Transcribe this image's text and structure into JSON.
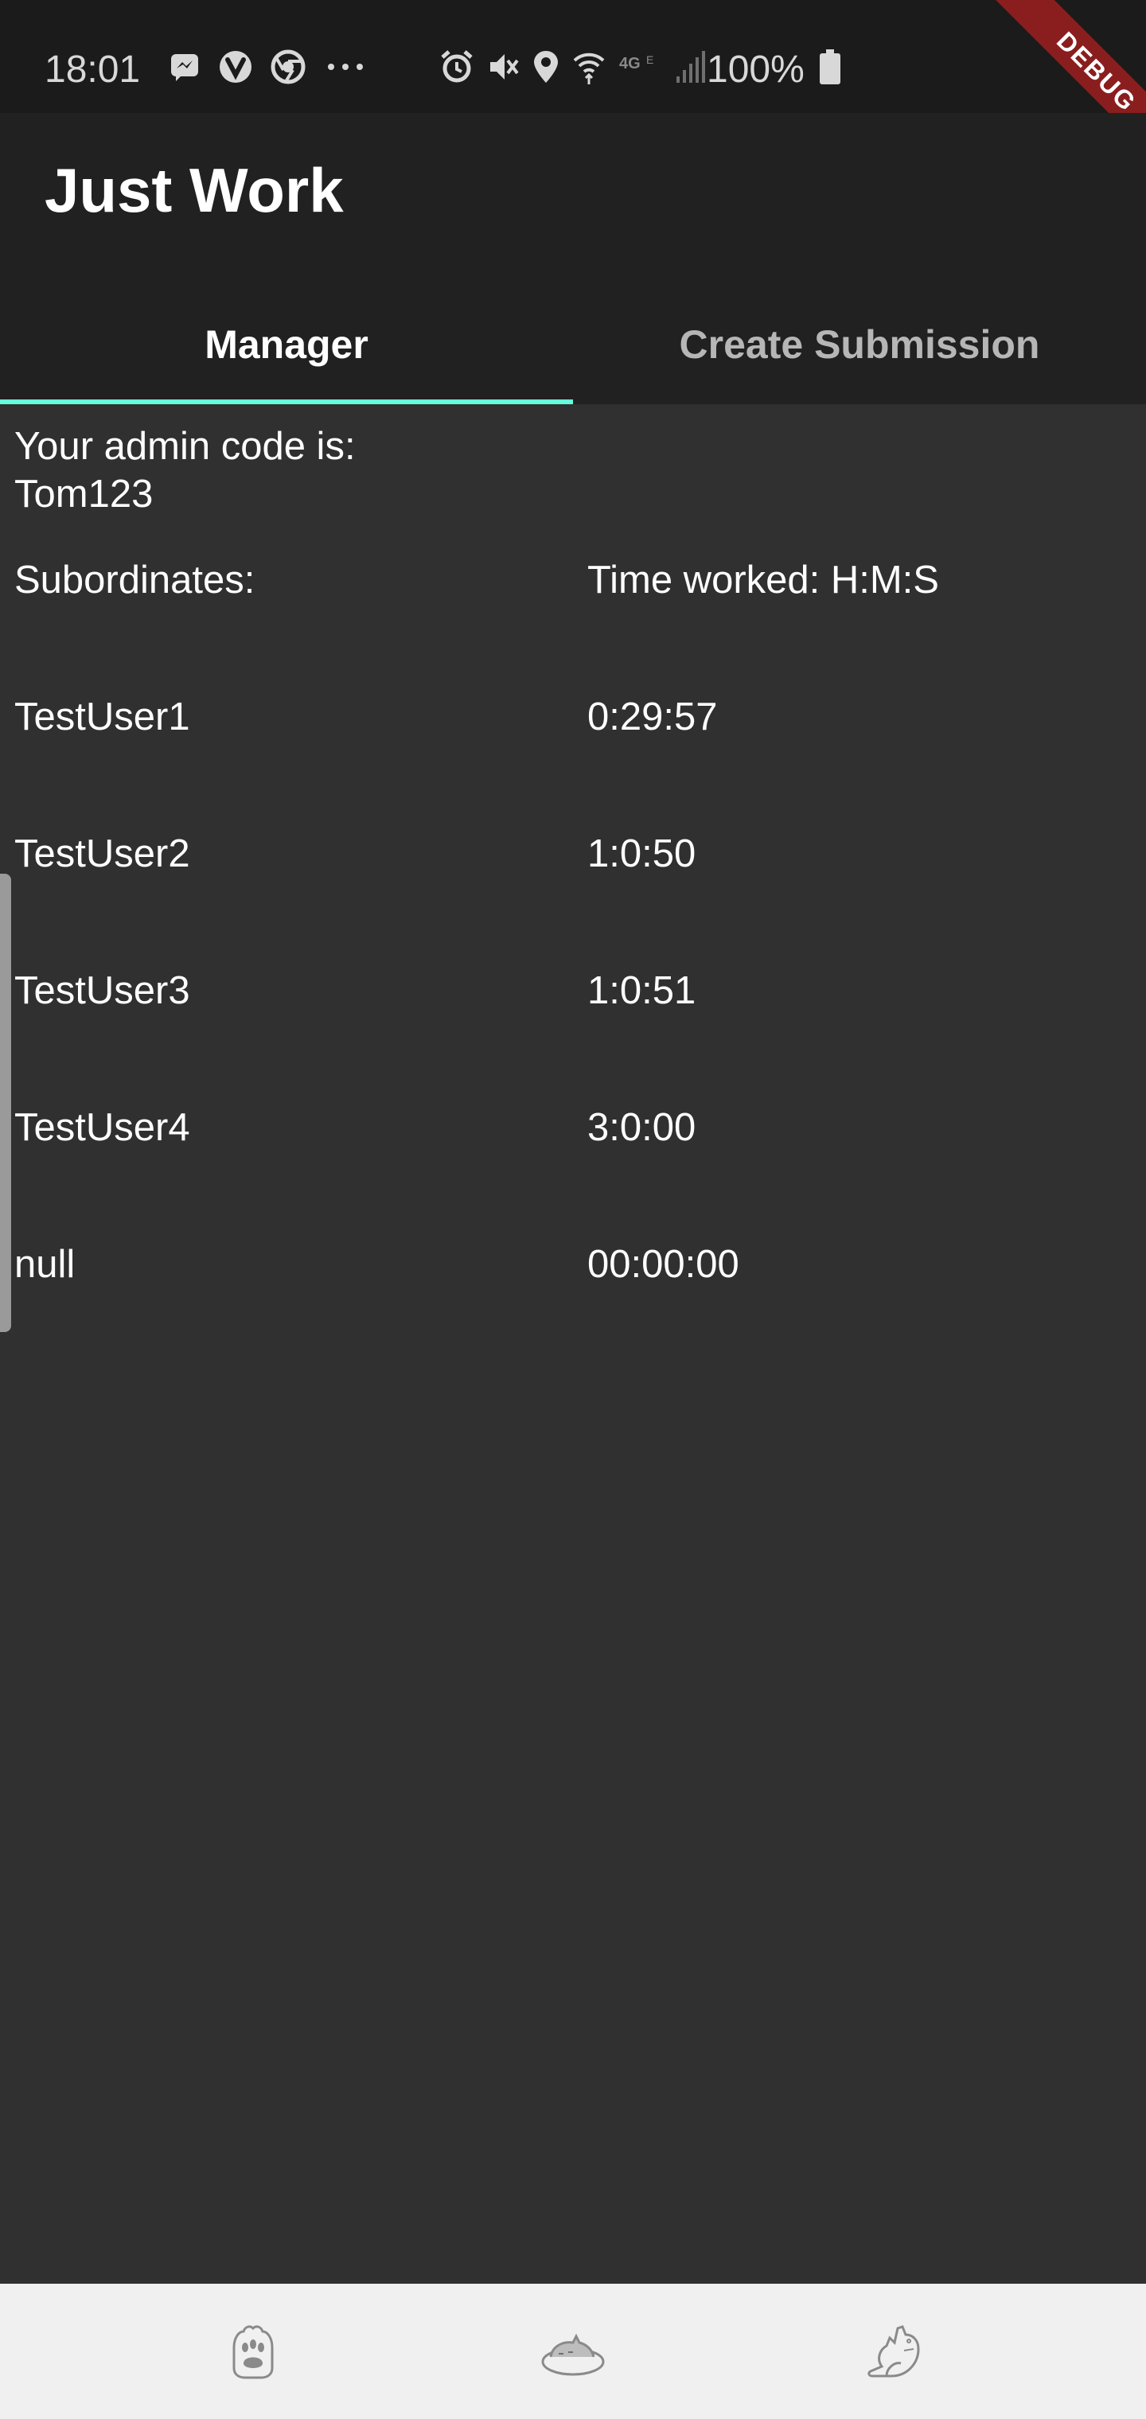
{
  "status_bar": {
    "time": "18:01",
    "battery": "100%",
    "icons_left": [
      "messenger-icon",
      "vivaldi-icon",
      "chrome-icon",
      "more-dots-icon"
    ],
    "icons_right": [
      "alarm-icon",
      "vibrate-icon",
      "location-icon",
      "wifi-icon",
      "network-4g-icon",
      "signal-icon",
      "battery-icon"
    ]
  },
  "debug_banner": "DEBUG",
  "app_bar": {
    "title": "Just Work"
  },
  "tabs": [
    {
      "label": "Manager",
      "selected": true
    },
    {
      "label": "Create Submission",
      "selected": false
    }
  ],
  "colors": {
    "accent": "#64ffda",
    "background": "#303030",
    "appbar": "#212121",
    "statusbar": "#1b1b1b",
    "bottom_nav": "#f0f0f0",
    "debug": "#8a1e1e"
  },
  "manager": {
    "admin_label": "Your admin code is:",
    "admin_code": "Tom123",
    "columns": {
      "name": "Subordinates:",
      "time": "Time worked: H:M:S"
    },
    "rows": [
      {
        "name": "TestUser1",
        "time": "0:29:57"
      },
      {
        "name": "TestUser2",
        "time": "1:0:50"
      },
      {
        "name": "TestUser3",
        "time": "1:0:51"
      },
      {
        "name": "TestUser4",
        "time": "3:0:00"
      },
      {
        "name": "null",
        "time": "00:00:00"
      }
    ]
  },
  "bottom_nav": [
    {
      "icon": "paw-icon"
    },
    {
      "icon": "sleeping-cat-icon"
    },
    {
      "icon": "cat-icon"
    }
  ]
}
